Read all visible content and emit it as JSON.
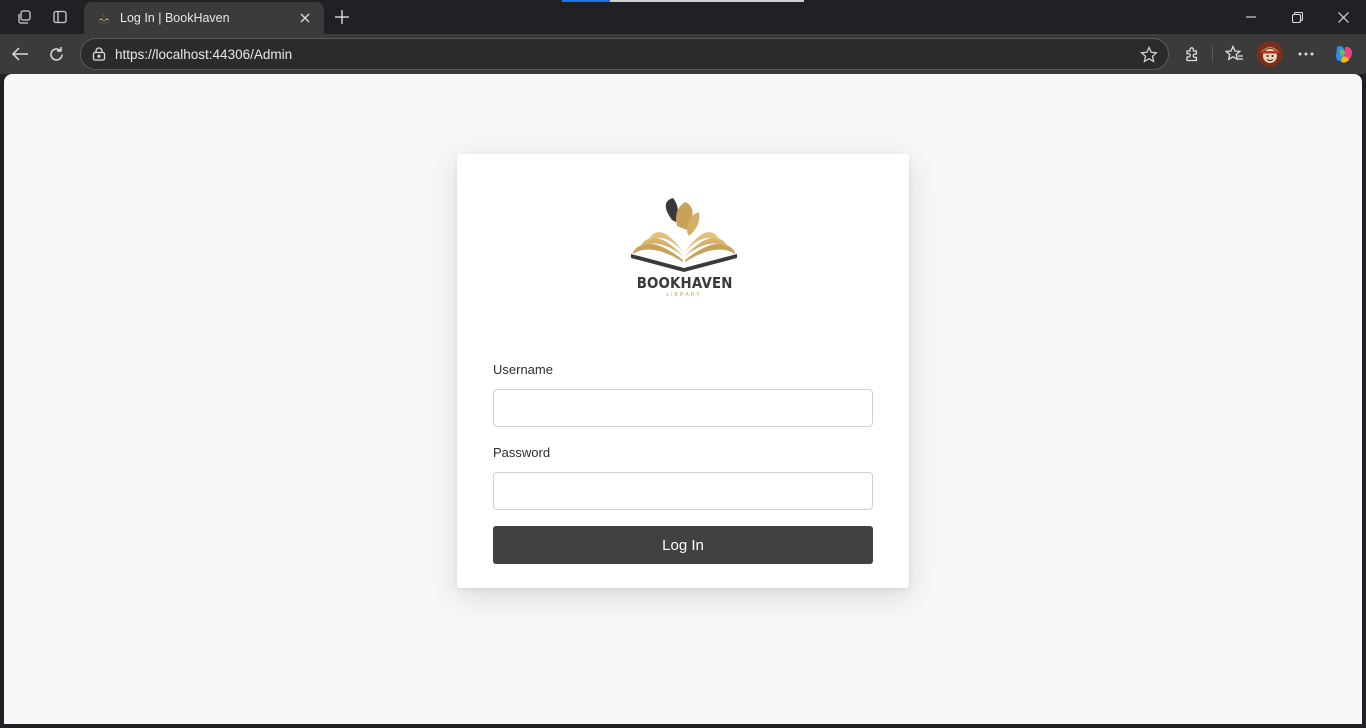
{
  "browser": {
    "tab": {
      "title": "Log In | BookHaven",
      "favicon": "bookhaven-favicon"
    },
    "address_bar": {
      "url": "https://localhost:44306/Admin"
    },
    "load_progress": 0.2,
    "icons": {
      "workspaces": "workspaces-icon",
      "tab_actions": "tab-actions-icon",
      "new_tab": "plus-icon",
      "back": "back-arrow-icon",
      "reload": "reload-icon",
      "site_info": "lock-icon",
      "favorite": "star-icon",
      "extensions": "puzzle-icon",
      "favorites": "favorites-icon",
      "profile": "avatar",
      "menu": "more-icon",
      "copilot": "copilot-icon"
    }
  },
  "page": {
    "logo": {
      "name": "BOOKHAVEN",
      "tagline": "LIBRARY"
    },
    "form": {
      "username_label": "Username",
      "username_value": "",
      "password_label": "Password",
      "password_value": "",
      "submit_label": "Log In"
    }
  },
  "colors": {
    "page_bg": "#f7f7f7",
    "card_bg": "#ffffff",
    "button_bg": "#414141",
    "logo_gold": "#c9a25a",
    "logo_dark": "#3a3a3a"
  }
}
